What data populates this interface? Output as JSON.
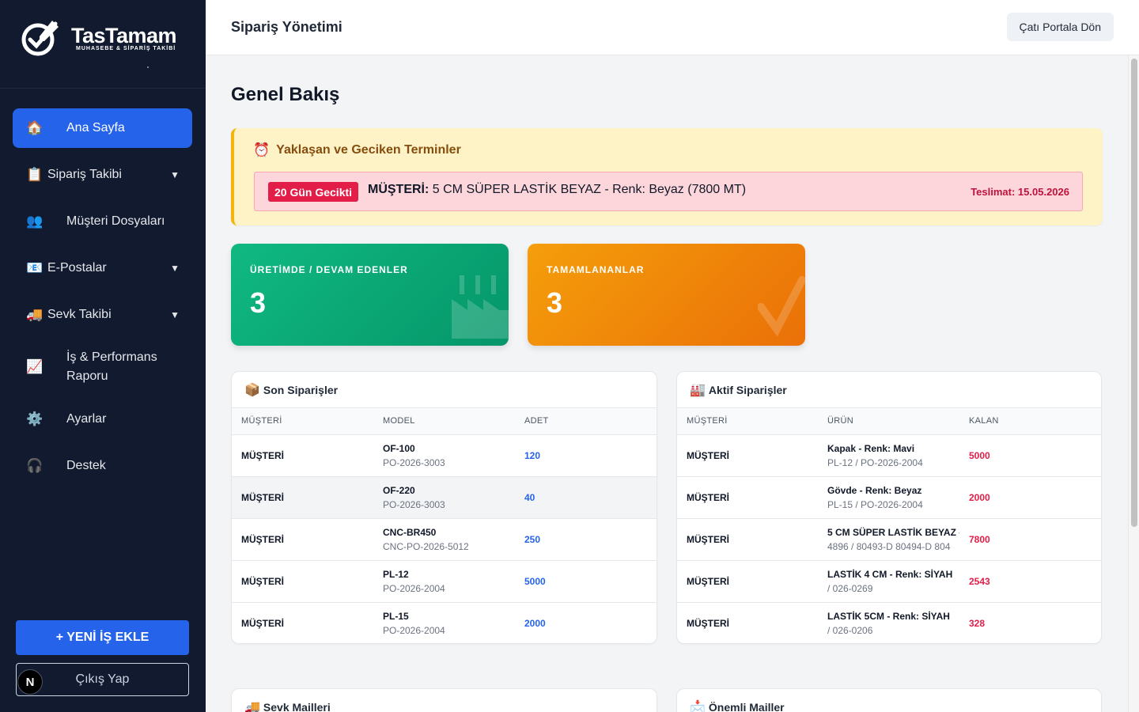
{
  "brand": {
    "name": "TasTamam",
    "tagline": "MUHASEBE & SİPARİŞ TAKİBİ"
  },
  "sidebar": {
    "items": [
      {
        "icon": "🏠",
        "label": "Ana Sayfa",
        "active": true
      },
      {
        "icon": "📋",
        "label": "Sipariş Takibi",
        "caret": "▼"
      },
      {
        "icon": "👥",
        "label": "Müşteri Dosyaları"
      },
      {
        "icon": "📧",
        "label": "E-Postalar",
        "caret": "▼"
      },
      {
        "icon": "🚚",
        "label": "Sevk Takibi",
        "caret": "▼"
      },
      {
        "icon": "📈",
        "label_line1": "İş & Performans",
        "label_line2": "Raporu"
      },
      {
        "icon": "⚙️",
        "label": "Ayarlar"
      },
      {
        "icon": "🎧",
        "label": "Destek"
      }
    ],
    "new_job_label": "+ YENİ İŞ EKLE",
    "logout_label": "Çıkış Yap",
    "n_badge": "N"
  },
  "topbar": {
    "title": "Sipariş Yönetimi",
    "portal_button": "Çatı Portala Dön"
  },
  "page": {
    "title": "Genel Bakış"
  },
  "alerts": {
    "icon": "⏰",
    "title": "Yaklaşan ve Geciken Terminler",
    "item": {
      "badge": "20 Gün Gecikti",
      "customer": "MÜŞTERİ:",
      "text": "5 CM SÜPER LASTİK BEYAZ - Renk: Beyaz (7800 MT)",
      "delivery": "Teslimat: 15.05.2026"
    }
  },
  "stats": {
    "in_production": {
      "label": "ÜRETİMDE / DEVAM EDENLER",
      "value": "3"
    },
    "completed": {
      "label": "TAMAMLANANLAR",
      "value": "3"
    }
  },
  "recent_orders": {
    "icon": "📦",
    "title": "Son Siparişler",
    "headers": [
      "MÜŞTERİ",
      "MODEL",
      "ADET"
    ],
    "rows": [
      {
        "customer": "MÜŞTERİ",
        "model": "OF-100",
        "po": "PO-2026-3003",
        "qty": "120"
      },
      {
        "customer": "MÜŞTERİ",
        "model": "OF-220",
        "po": "PO-2026-3003",
        "qty": "40"
      },
      {
        "customer": "MÜŞTERİ",
        "model": "CNC-BR450",
        "po": "CNC-PO-2026-5012",
        "qty": "250"
      },
      {
        "customer": "MÜŞTERİ",
        "model": "PL-12",
        "po": "PO-2026-2004",
        "qty": "5000"
      },
      {
        "customer": "MÜŞTERİ",
        "model": "PL-15",
        "po": "PO-2026-2004",
        "qty": "2000"
      }
    ]
  },
  "active_orders": {
    "icon": "🏭",
    "title": "Aktif Siparişler",
    "headers": [
      "MÜŞTERİ",
      "ÜRÜN",
      "KALAN"
    ],
    "rows": [
      {
        "customer": "MÜŞTERİ",
        "product": "Kapak - Renk: Mavi",
        "ref": "PL-12 / PO-2026-2004",
        "remaining": "5000"
      },
      {
        "customer": "MÜŞTERİ",
        "product": "Gövde - Renk: Beyaz",
        "ref": "PL-15 / PO-2026-2004",
        "remaining": "2000"
      },
      {
        "customer": "MÜŞTERİ",
        "product": "5 CM SÜPER LASTİK BEYAZ -",
        "ref": "4896 / 80493-D 80494-D 804",
        "remaining": "7800"
      },
      {
        "customer": "MÜŞTERİ",
        "product": "LASTİK 4 CM - Renk: SİYAH",
        "ref": "/ 026-0269",
        "remaining": "2543"
      },
      {
        "customer": "MÜŞTERİ",
        "product": "LASTİK 5CM - Renk: SİYAH",
        "ref": "/ 026-0206",
        "remaining": "328"
      }
    ]
  },
  "bottom_panels": {
    "shipping_mails": {
      "icon": "🚚",
      "title": "Sevk Mailleri"
    },
    "important_mails": {
      "icon": "📩",
      "title": "Önemli Mailler"
    }
  }
}
